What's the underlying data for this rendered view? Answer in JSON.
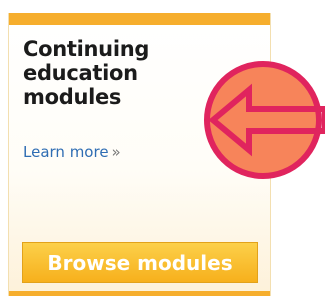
{
  "card": {
    "title": "Continuing education modules",
    "learn_more_label": "Learn more",
    "learn_more_suffix": "»",
    "browse_button_label": "Browse modules"
  },
  "badge": {
    "icon": "left-arrow-icon",
    "fill_color": "#f7845a",
    "ring_color": "#e0245e"
  },
  "colors": {
    "accent": "#f6ae2d",
    "link": "#2f6db3"
  }
}
